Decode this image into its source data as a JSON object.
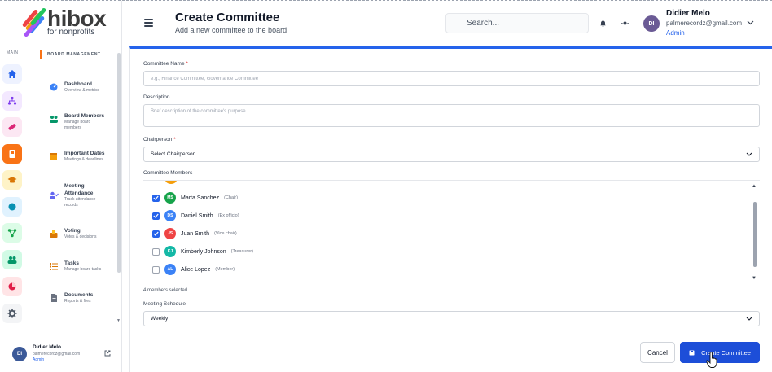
{
  "brand": {
    "name": "hibox",
    "tagline": "for nonprofits"
  },
  "rail": {
    "label": "MAIN",
    "items": [
      {
        "icon": "home-icon",
        "bg": "#eef2ff",
        "fg": "#2563eb"
      },
      {
        "icon": "org-chart-icon",
        "bg": "#f3e8ff",
        "fg": "#7c3aed"
      },
      {
        "icon": "pill-icon",
        "bg": "#fce7f3",
        "fg": "#db2777"
      },
      {
        "icon": "board-icon",
        "bg": "#f97316",
        "fg": "#ffffff"
      },
      {
        "icon": "cap-icon",
        "bg": "#fef3c7",
        "fg": "#d97706"
      },
      {
        "icon": "circle-icon",
        "bg": "#e0f2fe",
        "fg": "#0891b2"
      },
      {
        "icon": "share-icon",
        "bg": "#dcfce7",
        "fg": "#16a34a"
      },
      {
        "icon": "people-icon",
        "bg": "#d1fae5",
        "fg": "#059669"
      },
      {
        "icon": "pie-icon",
        "bg": "#ffe4e6",
        "fg": "#e11d48"
      },
      {
        "icon": "gear-icon",
        "bg": "#f3f4f6",
        "fg": "#4b5563"
      }
    ]
  },
  "menu": {
    "section": "BOARD MANAGEMENT",
    "items": [
      {
        "title": "Dashboard",
        "sub": "Overview & metrics"
      },
      {
        "title": "Board Members",
        "sub": "Manage board members"
      },
      {
        "title": "Important Dates",
        "sub": "Meetings & deadlines"
      },
      {
        "title": "Meeting Attendance",
        "sub": "Track attendance records"
      },
      {
        "title": "Voting",
        "sub": "Votes & decisions"
      },
      {
        "title": "Tasks",
        "sub": "Manage board tasks"
      },
      {
        "title": "Documents",
        "sub": "Reports & files"
      }
    ]
  },
  "footer_user": {
    "initials": "DI",
    "name": "Didier Melo",
    "email": "palmerecordz@gmail.com",
    "role": "Admin"
  },
  "header": {
    "title": "Create Committee",
    "subtitle": "Add a new committee to the board",
    "search_placeholder": "Search...",
    "user": {
      "initials": "DI",
      "name": "Didier Melo",
      "email": "palmerecordz@gmail.com",
      "role": "Admin"
    }
  },
  "form": {
    "name_label": "Committee Name",
    "name_placeholder": "e.g., Finance Committee, Governance Committee",
    "desc_label": "Description",
    "desc_placeholder": "Brief description of the committee's purpose...",
    "chair_label": "Chairperson",
    "chair_value": "Select Chairperson",
    "members_label": "Committee Members",
    "members": [
      {
        "initials": "MS",
        "name": "Marta Sanchez",
        "role": "(Chair)",
        "checked": true,
        "color": "#16a34a"
      },
      {
        "initials": "DS",
        "name": "Daniel Smith",
        "role": "(Ex officio)",
        "checked": true,
        "color": "#3b82f6"
      },
      {
        "initials": "JS",
        "name": "Juan Smith",
        "role": "(Vice chair)",
        "checked": true,
        "color": "#ef4444"
      },
      {
        "initials": "KJ",
        "name": "Kimberly Johnson",
        "role": "(Treasurer)",
        "checked": false,
        "color": "#14b8a6"
      },
      {
        "initials": "AL",
        "name": "Alice Lopez",
        "role": "(Member)",
        "checked": false,
        "color": "#3b82f6"
      }
    ],
    "members_selected": "4 members selected",
    "schedule_label": "Meeting Schedule",
    "schedule_value": "Weekly",
    "cancel_label": "Cancel",
    "create_label": "Create Committee"
  },
  "required_mark": "*"
}
